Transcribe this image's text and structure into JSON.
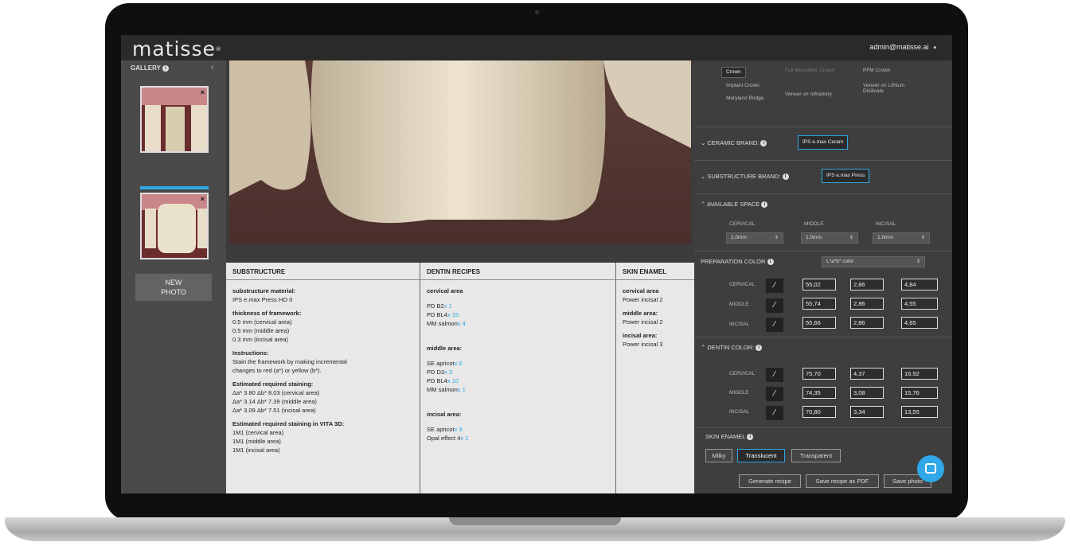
{
  "app": {
    "logo": "matisse",
    "logo_mark": "®",
    "user": "admin@matisse.ai",
    "user_caret": "▾"
  },
  "sidebar": {
    "gallery_label": "GALLERY",
    "info": "i",
    "collapse": "‹",
    "thumb_close": "×",
    "new_photo_line1": "NEW",
    "new_photo_line2": "PHOTO"
  },
  "report": {
    "substructure": {
      "title": "SUBSTRUCTURE",
      "material_h": "substructure material:",
      "material": "IPS e.max Press HO 0",
      "thickness_h": "thickness of framework:",
      "t1": "0.5 mm (cervical area)",
      "t2": "0.5 mm (middle area)",
      "t3": "0.3 mm (incisal area)",
      "instr_h": "Instructions:",
      "instr1": "Stain the framework by making incremental",
      "instr2": "changes to red (a*) or yellow (b*).",
      "est_h": "Estimated required staining:",
      "e1": "Δa* 3.80 Δb* 8.03 (cervical area)",
      "e2": "Δa* 3.14 Δb* 7.39 (middle area)",
      "e3": "Δa* 3.09 Δb* 7.51 (incisal area)",
      "vita_h": "Estimated required staining in VITA 3D:",
      "v1": "1M1 (cervical area)",
      "v2": "1M1 (middle area)",
      "v3": "1M1 (incisal area)"
    },
    "dentin": {
      "title": "DENTIN RECIPES",
      "cervical_h": "cervical area",
      "c1": "PD B2",
      "c1q": "x 1",
      "c2": "PD BL4",
      "c2q": "x 15",
      "c3": "MM salmon",
      "c3q": "x 4",
      "middle_h": "middle area:",
      "m1": "SE apricot",
      "m1q": "x 6",
      "m2": "PD D3",
      "m2q": "x 3",
      "m3": "PD BL4",
      "m3q": "x 10",
      "m4": "MM salmon",
      "m4q": "x 1",
      "incisal_h": "incisal area:",
      "i1": "SE apricot",
      "i1q": "x 9",
      "i2": "Opal effect 4",
      "i2q": "x 1"
    },
    "enamel": {
      "title": "SKIN ENAMEL",
      "cervical_h": "cervical area",
      "c": "Power incisal 2",
      "middle_h": "middle area:",
      "m": "Power incisal 2",
      "incisal_h": "incisal area:",
      "i": "Power incisal 3"
    }
  },
  "right": {
    "types": [
      "Crown",
      "Full Monolithic Crown",
      "PFM Crown",
      "Implant Crown",
      "Veneer on refractory",
      "Veneer on Lithium Disilicate",
      "Maryland Bridge"
    ],
    "ceramic_label": "CERAMIC BRAND:",
    "ceramic_value": "IPS e.max Ceram",
    "substructure_label": "SUBSTRUCTURE BRAND:",
    "substructure_value": "IPS e.max Press",
    "space_label": "AVAILABLE SPACE",
    "space_cols": [
      "CERVICAL",
      "MIDDLE",
      "INCISAL"
    ],
    "space_values": [
      "1.0mm",
      "1.0mm",
      "1.0mm"
    ],
    "prep_label": "PREPARATION COLOR",
    "prep_select": "L*a*b* color",
    "rows": [
      "CERVICAL",
      "MIDDLE",
      "INCISAL"
    ],
    "prep_values": [
      [
        "55,02",
        "2,86",
        "4,84"
      ],
      [
        "55,74",
        "2,86",
        "4,55"
      ],
      [
        "55,66",
        "2,86",
        "4,65"
      ]
    ],
    "dentin_label": "DENTIN COLOR:",
    "dentin_values": [
      [
        "75,70",
        "4,37",
        "16,92"
      ],
      [
        "74,35",
        "3,08",
        "15,76"
      ],
      [
        "70,80",
        "3,34",
        "13,55"
      ]
    ],
    "skin_label": "SKIN ENAMEL",
    "skin_options": [
      "Milky",
      "Translucent",
      "Transparent"
    ],
    "buttons": [
      "Generate recipe",
      "Save recipe as PDF",
      "Save photo"
    ]
  },
  "colors": {
    "accent": "#2fa7e8",
    "panel": "#3e3e3e",
    "report_bg": "#e8e8e8"
  }
}
